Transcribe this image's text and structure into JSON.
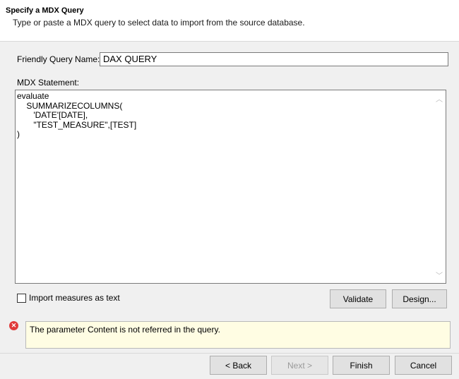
{
  "header": {
    "title": "Specify a MDX Query",
    "subtitle": "Type or paste a MDX query to select data to import from the source database."
  },
  "form": {
    "friendly_name_label": "Friendly Query Name:",
    "friendly_name_value": "DAX QUERY",
    "mdx_label": "MDX Statement:",
    "mdx_statement": "evaluate\n    SUMMARIZECOLUMNS(\n       'DATE'[DATE],\n       \"TEST_MEASURE\",[TEST]\n)",
    "import_measures_label": "Import measures as text",
    "import_measures_checked": false
  },
  "actions": {
    "validate_label": "Validate",
    "design_label": "Design..."
  },
  "message": {
    "type": "error",
    "icon": "error-icon",
    "text": "The parameter Content is not referred in the query."
  },
  "footer": {
    "back_label": "< Back",
    "next_label": "Next >",
    "finish_label": "Finish",
    "cancel_label": "Cancel"
  },
  "colors": {
    "message_background": "#fffde3",
    "error_icon": "#e03a3a",
    "button_face": "#e1e1e1"
  }
}
